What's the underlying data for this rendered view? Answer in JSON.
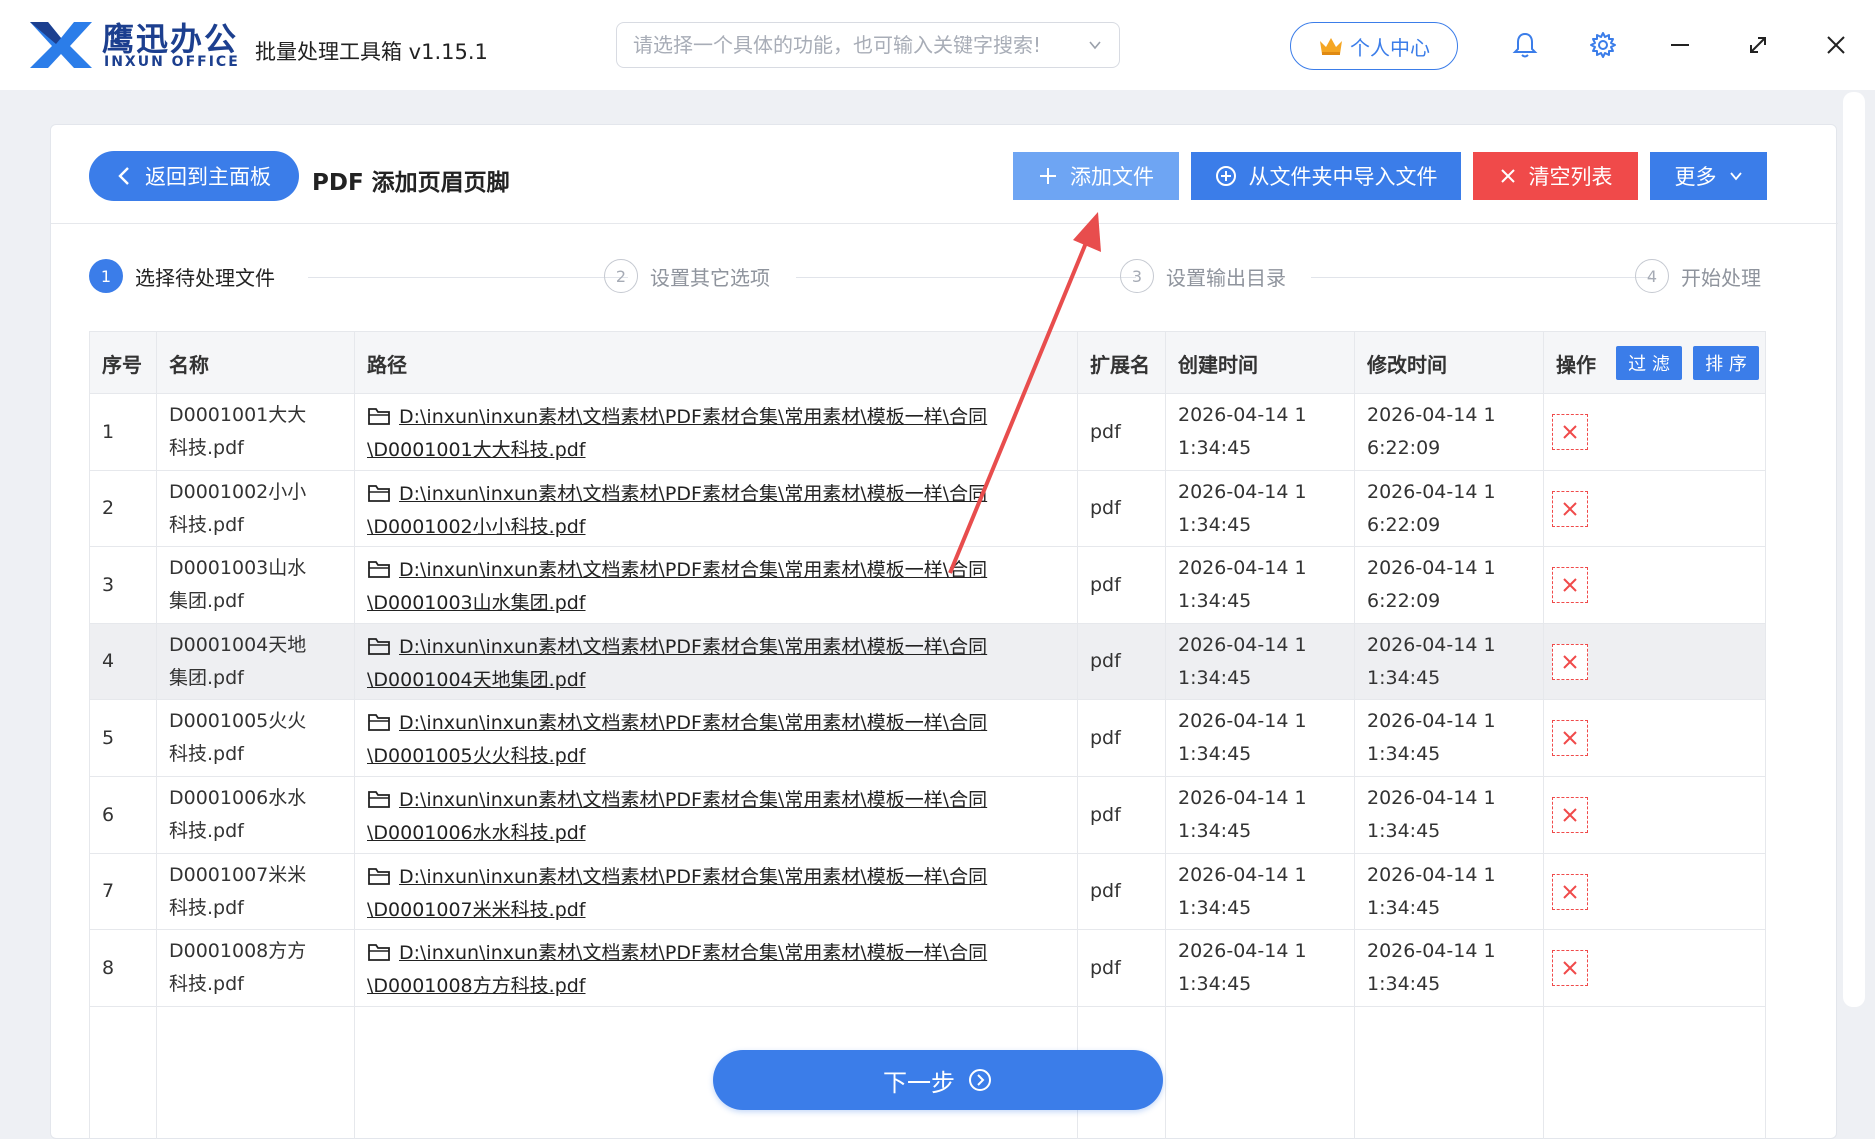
{
  "app": {
    "brand_cn": "鹰迅办公",
    "brand_en": "INXUN OFFICE",
    "title": "批量处理工具箱 v1.15.1",
    "search_placeholder": "请选择一个具体的功能，也可输入关键字搜索!",
    "user_center": "个人中心"
  },
  "toolbar": {
    "back_label": "返回到主面板",
    "page_title": "PDF 添加页眉页脚",
    "add_file": "添加文件",
    "import_folder": "从文件夹中导入文件",
    "clear_list": "清空列表",
    "more": "更多"
  },
  "steps": [
    {
      "num": "1",
      "label": "选择待处理文件"
    },
    {
      "num": "2",
      "label": "设置其它选项"
    },
    {
      "num": "3",
      "label": "设置输出目录"
    },
    {
      "num": "4",
      "label": "开始处理"
    }
  ],
  "table": {
    "headers": {
      "index": "序号",
      "name": "名称",
      "path": "路径",
      "ext": "扩展名",
      "created": "创建时间",
      "modified": "修改时间",
      "action": "操作",
      "filter": "过 滤",
      "sort": "排 序"
    },
    "rows": [
      {
        "index": "1",
        "name": "D0001001大大科技.pdf",
        "path": "D:\\inxun\\inxun素材\\文档素材\\PDF素材合集\\常用素材\\模板一样\\合同\\D0001001大大科技.pdf",
        "ext": "pdf",
        "created": "2026-04-14 11:34:45",
        "modified": "2026-04-14 16:22:09"
      },
      {
        "index": "2",
        "name": "D0001002小小科技.pdf",
        "path": "D:\\inxun\\inxun素材\\文档素材\\PDF素材合集\\常用素材\\模板一样\\合同\\D0001002小小科技.pdf",
        "ext": "pdf",
        "created": "2026-04-14 11:34:45",
        "modified": "2026-04-14 16:22:09"
      },
      {
        "index": "3",
        "name": "D0001003山水集团.pdf",
        "path": "D:\\inxun\\inxun素材\\文档素材\\PDF素材合集\\常用素材\\模板一样\\合同\\D0001003山水集团.pdf",
        "ext": "pdf",
        "created": "2026-04-14 11:34:45",
        "modified": "2026-04-14 16:22:09"
      },
      {
        "index": "4",
        "name": "D0001004天地集团.pdf",
        "path": "D:\\inxun\\inxun素材\\文档素材\\PDF素材合集\\常用素材\\模板一样\\合同\\D0001004天地集团.pdf",
        "ext": "pdf",
        "created": "2026-04-14 11:34:45",
        "modified": "2026-04-14 11:34:45"
      },
      {
        "index": "5",
        "name": "D0001005火火科技.pdf",
        "path": "D:\\inxun\\inxun素材\\文档素材\\PDF素材合集\\常用素材\\模板一样\\合同\\D0001005火火科技.pdf",
        "ext": "pdf",
        "created": "2026-04-14 11:34:45",
        "modified": "2026-04-14 11:34:45"
      },
      {
        "index": "6",
        "name": "D0001006水水科技.pdf",
        "path": "D:\\inxun\\inxun素材\\文档素材\\PDF素材合集\\常用素材\\模板一样\\合同\\D0001006水水科技.pdf",
        "ext": "pdf",
        "created": "2026-04-14 11:34:45",
        "modified": "2026-04-14 11:34:45"
      },
      {
        "index": "7",
        "name": "D0001007米米科技.pdf",
        "path": "D:\\inxun\\inxun素材\\文档素材\\PDF素材合集\\常用素材\\模板一样\\合同\\D0001007米米科技.pdf",
        "ext": "pdf",
        "created": "2026-04-14 11:34:45",
        "modified": "2026-04-14 11:34:45"
      },
      {
        "index": "8",
        "name": "D0001008方方科技.pdf",
        "path": "D:\\inxun\\inxun素材\\文档素材\\PDF素材合集\\常用素材\\模板一样\\合同\\D0001008方方科技.pdf",
        "ext": "pdf",
        "created": "2026-04-14 11:34:45",
        "modified": "2026-04-14 11:34:45"
      }
    ]
  },
  "footer": {
    "next_label": "下一步"
  },
  "colors": {
    "primary": "#3b7de9",
    "primary_light": "#6ea5f3",
    "danger": "#f04a4a",
    "arrow": "#e84d4d"
  }
}
